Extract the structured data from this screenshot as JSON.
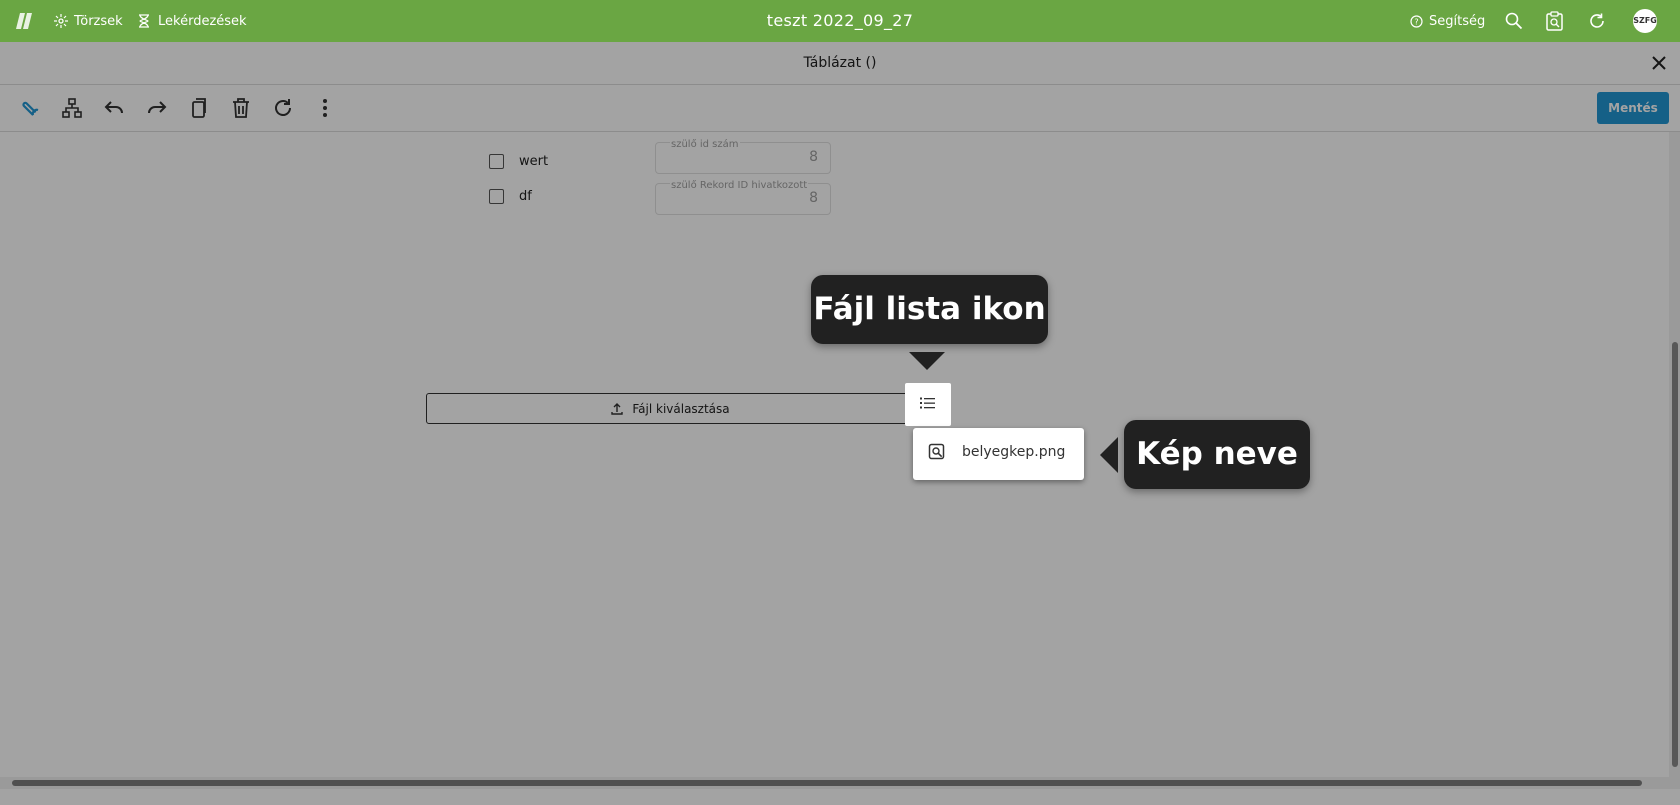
{
  "topbar": {
    "nav": [
      {
        "label": "Törzsek",
        "icon": "sparkle-icon"
      },
      {
        "label": "Lekérdezések",
        "icon": "hourglass-icon"
      }
    ],
    "title": "teszt 2022_09_27",
    "help_label": "Segítség",
    "avatar_initials": "SZFG",
    "color": "#6aa643"
  },
  "subheader": {
    "title": "Táblázat ()"
  },
  "toolbar": {
    "icons": [
      "wrench-icon",
      "hierarchy-icon",
      "undo-icon",
      "redo-icon",
      "copy-icon",
      "delete-icon",
      "refresh-icon",
      "more-vert-icon"
    ],
    "save_label": "Mentés",
    "accent": "#2196d3"
  },
  "form": {
    "checkboxes": [
      {
        "label": "wert",
        "checked": false
      },
      {
        "label": "df",
        "checked": false
      }
    ],
    "fields": [
      {
        "label": "szülő id szám",
        "value": "8"
      },
      {
        "label": "szülő Rekord ID hivatkozott",
        "value": "8"
      }
    ],
    "file_button_label": "Fájl kiválasztása"
  },
  "file_list": {
    "items": [
      {
        "name": "belyegkep.png"
      }
    ]
  },
  "tooltips": {
    "list_icon": "Fájl lista ikon",
    "image_name": "Kép neve"
  }
}
